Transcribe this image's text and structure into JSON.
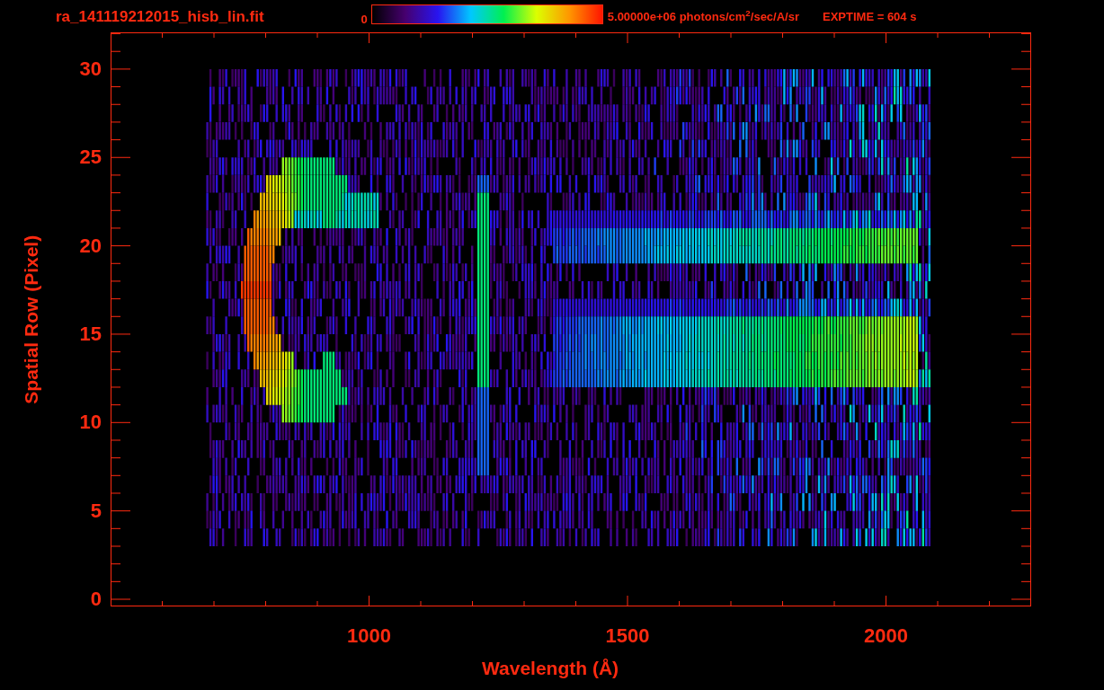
{
  "header": {
    "file_name": "ra_141119212015_hisb_lin.fit",
    "colorbar": {
      "min_label": "0",
      "max_label": "5.00000e+06 photons/cm$^{2}$/sec/A/sr"
    },
    "exposure": "EXPTIME = 604 s"
  },
  "plot": {
    "xlabel": "Wavelength (Å)",
    "ylabel": "Spatial Row (Pixel)",
    "xticks": [
      "1000",
      "1500",
      "2000"
    ],
    "yticks": [
      "30",
      "25",
      "20",
      "15",
      "10",
      "5",
      "0"
    ]
  }
}
